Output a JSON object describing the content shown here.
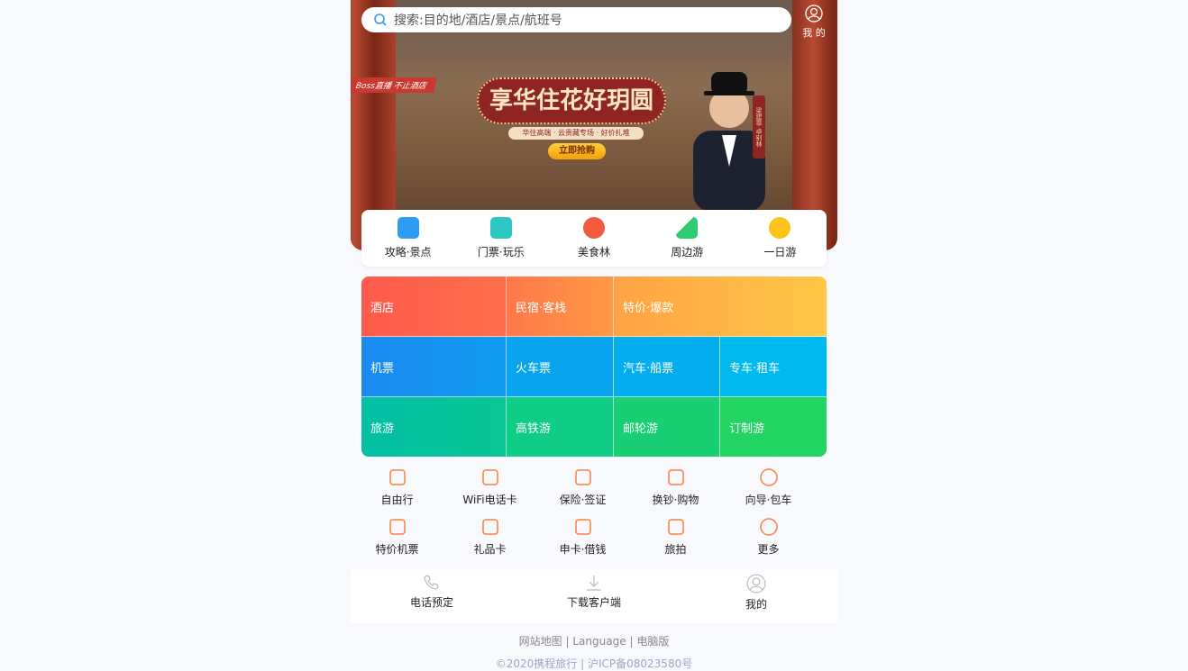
{
  "search": {
    "placeholder": "搜索:目的地/酒店/景点/航班号"
  },
  "header": {
    "mine": "我 的"
  },
  "banner": {
    "tag": "Boss直播 不止酒店",
    "title": "享华住花好玥圆",
    "subtitle": "华住高端 · 云贵藏专场 · 好价扎堆",
    "button": "立即抢购",
    "vertical": "梁建章 卓别林"
  },
  "quick": [
    {
      "label": "攻略·景点",
      "color": "#2e9cf5"
    },
    {
      "label": "门票·玩乐",
      "color": "#2cc7c2"
    },
    {
      "label": "美食林",
      "color": "#f35a3f"
    },
    {
      "label": "周边游",
      "color": "#2ecc71"
    },
    {
      "label": "一日游",
      "color": "#ffc21a"
    }
  ],
  "grid": {
    "hotel": "酒店",
    "homestay": "民宿·客栈",
    "deals": "特价·爆款",
    "flight": "机票",
    "train": "火车票",
    "bus": "汽车·船票",
    "car": "专车·租车",
    "travel": "旅游",
    "hsr": "高铁游",
    "cruise": "邮轮游",
    "custom": "订制游"
  },
  "services": [
    "自由行",
    "WiFi电话卡",
    "保险·签证",
    "换钞·购物",
    "向导·包车",
    "特价机票",
    "礼品卡",
    "申卡·借钱",
    "旅拍",
    "更多"
  ],
  "bottom": {
    "phone": "电话预定",
    "download": "下载客户端",
    "mine": "我的"
  },
  "footer": {
    "sitemap": "网站地图",
    "language": "Language",
    "pc": "电脑版",
    "sep": "|",
    "copyright": "©2020携程旅行 | 沪ICP备08023580号"
  },
  "colors": {
    "accent": "#ff7d3f"
  }
}
